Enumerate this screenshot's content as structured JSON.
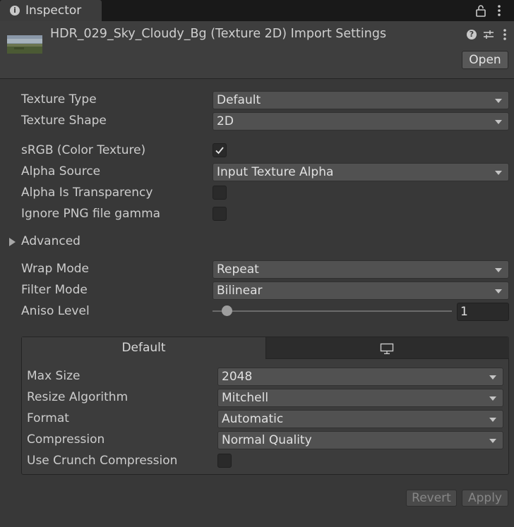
{
  "tab": {
    "title": "Inspector",
    "info_icon": "info-icon",
    "lock_icon": "lock-icon",
    "menu_icon": "kebab-menu-icon"
  },
  "header": {
    "title": "HDR_029_Sky_Cloudy_Bg (Texture 2D) Import Settings",
    "open_label": "Open",
    "icons": [
      "help-icon",
      "preset-icon",
      "kebab-menu-icon"
    ]
  },
  "settings": {
    "texture_type": {
      "label": "Texture Type",
      "value": "Default"
    },
    "texture_shape": {
      "label": "Texture Shape",
      "value": "2D"
    },
    "srgb": {
      "label": "sRGB (Color Texture)",
      "checked": true
    },
    "alpha_source": {
      "label": "Alpha Source",
      "value": "Input Texture Alpha"
    },
    "alpha_is_transparency": {
      "label": "Alpha Is Transparency",
      "checked": false
    },
    "ignore_png_gamma": {
      "label": "Ignore PNG file gamma",
      "checked": false
    },
    "advanced": {
      "label": "Advanced",
      "expanded": false
    },
    "wrap_mode": {
      "label": "Wrap Mode",
      "value": "Repeat"
    },
    "filter_mode": {
      "label": "Filter Mode",
      "value": "Bilinear"
    },
    "aniso_level": {
      "label": "Aniso Level",
      "value": "1",
      "slider_fraction": 0.06
    }
  },
  "platform": {
    "tabs": [
      {
        "label": "Default",
        "selected": true
      },
      {
        "icon": "monitor-icon",
        "selected": false
      }
    ],
    "max_size": {
      "label": "Max Size",
      "value": "2048"
    },
    "resize_algorithm": {
      "label": "Resize Algorithm",
      "value": "Mitchell"
    },
    "format": {
      "label": "Format",
      "value": "Automatic"
    },
    "compression": {
      "label": "Compression",
      "value": "Normal Quality"
    },
    "use_crunch": {
      "label": "Use Crunch Compression",
      "checked": false
    }
  },
  "footer": {
    "revert_label": "Revert",
    "apply_label": "Apply"
  },
  "colors": {
    "panel_bg": "#383838",
    "header_bg": "#3e3e3e",
    "dropdown_bg": "#515151",
    "field_bg": "#2a2a2a",
    "tabbar_bg": "#191919"
  }
}
